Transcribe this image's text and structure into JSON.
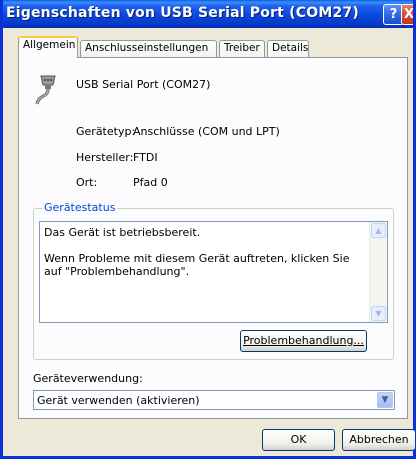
{
  "window": {
    "title": "Eigenschaften von USB Serial Port (COM27)",
    "help_glyph": "?",
    "close_glyph": "X"
  },
  "tabs": [
    {
      "label": "Allgemein",
      "active": true
    },
    {
      "label": "Anschlusseinstellungen",
      "active": false
    },
    {
      "label": "Treiber",
      "active": false
    },
    {
      "label": "Details",
      "active": false
    }
  ],
  "device": {
    "icon": "serial-port-connector-icon",
    "name": "USB Serial Port (COM27)",
    "props": [
      {
        "label": "Gerätetyp:",
        "value": "Anschlüsse (COM und LPT)"
      },
      {
        "label": "Hersteller:",
        "value": "FTDI"
      },
      {
        "label": "Ort:",
        "value": "Pfad 0"
      }
    ]
  },
  "status": {
    "group_title": "Gerätestatus",
    "text": "Das Gerät ist betriebsbereit.\n\nWenn Probleme mit diesem Gerät auftreten, klicken Sie auf \"Problembehandlung\".",
    "troubleshoot_label": "Problembehandlung..."
  },
  "usage": {
    "label": "Geräteverwendung:",
    "selected": "Gerät verwenden (aktivieren)"
  },
  "footer": {
    "ok_label": "OK",
    "cancel_label": "Abbrechen"
  },
  "colors": {
    "titlebar": "#0A48DE",
    "dialog_bg": "#ECE9D8",
    "group_title": "#0046D5",
    "tab_highlight": "#FFC83C"
  }
}
